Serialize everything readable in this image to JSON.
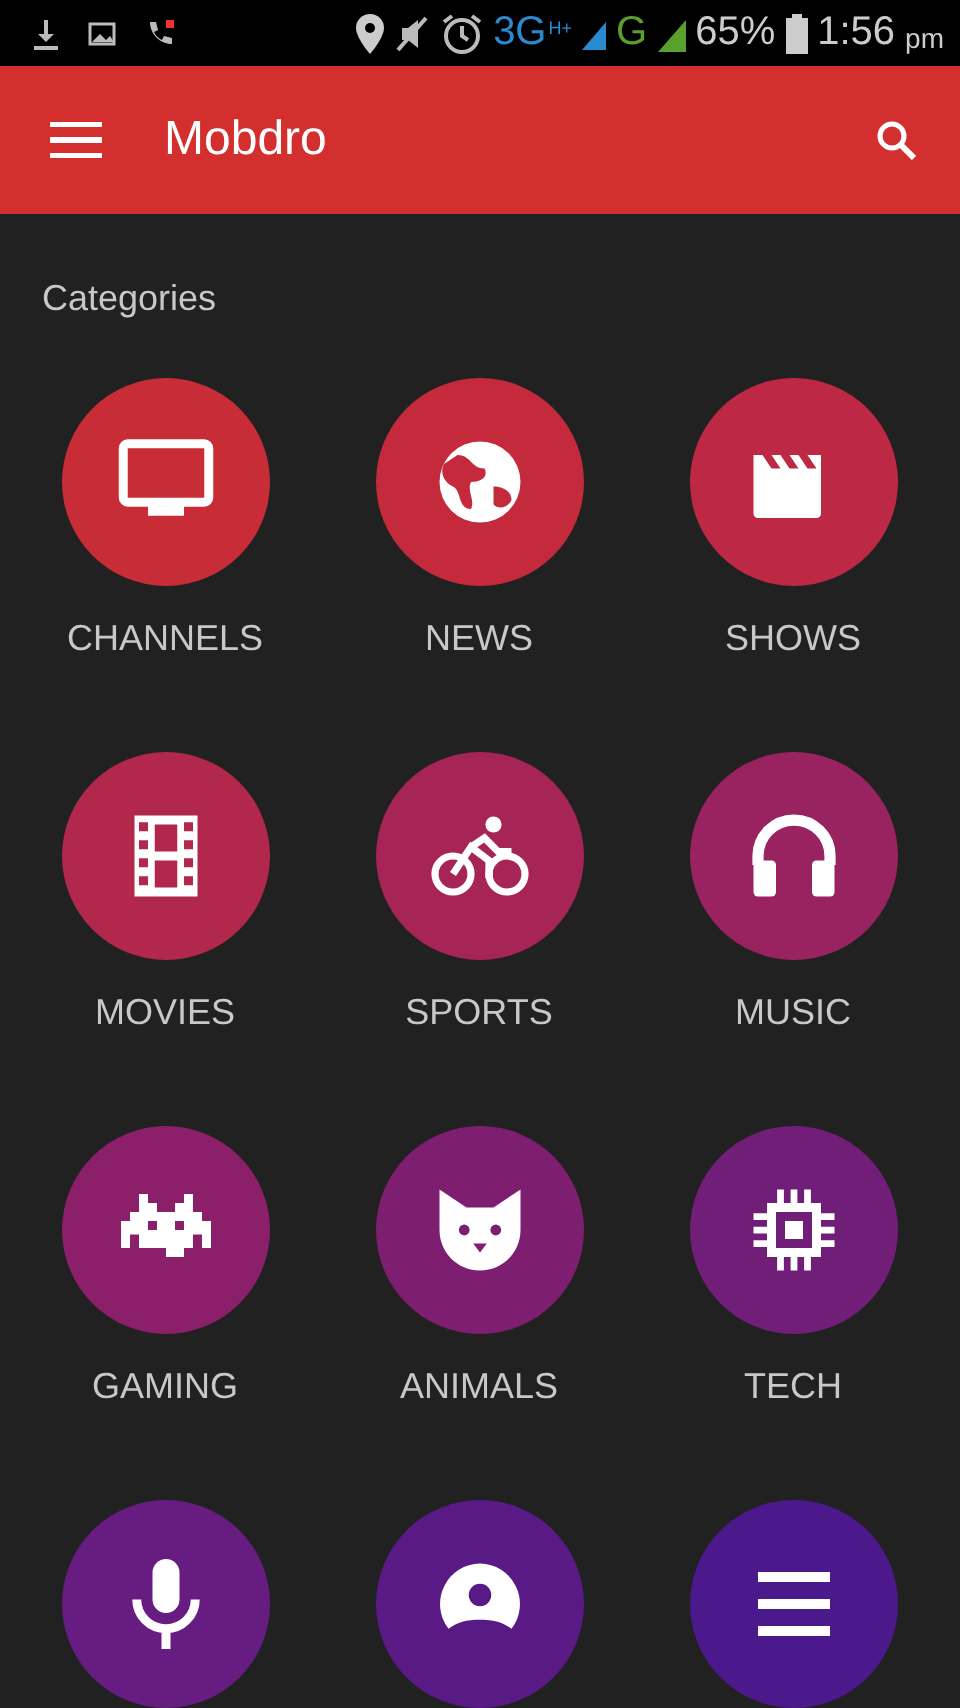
{
  "status_bar": {
    "network": "3G",
    "network_badge": "H+",
    "network_2": "G",
    "battery": "65%",
    "time": "1:56",
    "time_suffix": "pm"
  },
  "app_bar": {
    "title": "Mobdro"
  },
  "section": {
    "title": "Categories"
  },
  "categories": [
    {
      "label": "CHANNELS",
      "color": "#c82c36"
    },
    {
      "label": "NEWS",
      "color": "#c42a3c"
    },
    {
      "label": "SHOWS",
      "color": "#bd2844"
    },
    {
      "label": "MOVIES",
      "color": "#b2274c"
    },
    {
      "label": "SPORTS",
      "color": "#a62456"
    },
    {
      "label": "MUSIC",
      "color": "#992260"
    },
    {
      "label": "GAMING",
      "color": "#8b1f69"
    },
    {
      "label": "ANIMALS",
      "color": "#7e1e70"
    },
    {
      "label": "TECH",
      "color": "#711e78"
    },
    {
      "color": "#661c80"
    },
    {
      "color": "#591a86"
    },
    {
      "color": "#4b198c"
    }
  ]
}
